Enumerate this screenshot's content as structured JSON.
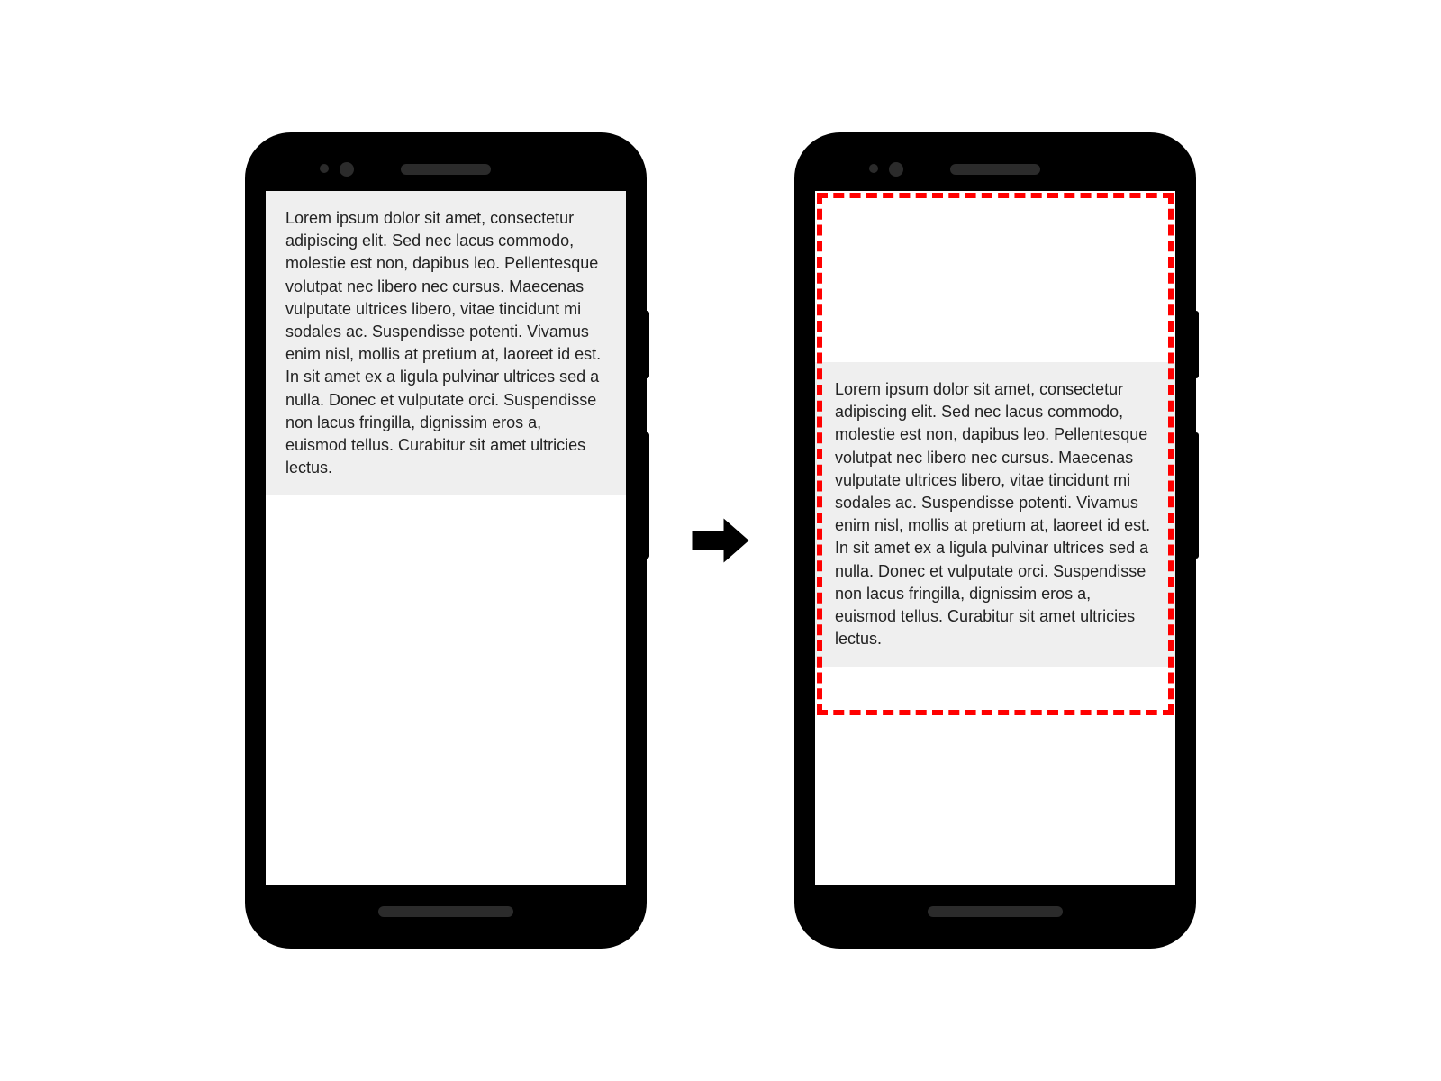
{
  "phone_left": {
    "body_text": "Lorem ipsum dolor sit amet, consectetur adipiscing elit. Sed nec lacus commodo, molestie est non, dapibus leo. Pellentesque volutpat nec libero nec cursus. Maecenas vulputate ultrices libero, vitae tincidunt mi sodales ac. Suspendisse potenti. Vivamus enim nisl, mollis at pretium at, laoreet id est. In sit amet ex a ligula pulvinar ultrices sed a nulla. Donec et vulputate orci. Suspendisse non lacus fringilla, dignissim eros a, euismod tellus. Curabitur sit amet ultricies lectus."
  },
  "phone_right": {
    "body_text": "Lorem ipsum dolor sit amet, consectetur adipiscing elit. Sed nec lacus commodo, molestie est non, dapibus leo. Pellentesque volutpat nec libero nec cursus. Maecenas vulputate ultrices libero, vitae tincidunt mi sodales ac. Suspendisse potenti. Vivamus enim nisl, mollis at pretium at, laoreet id est. In sit amet ex a ligula pulvinar ultrices sed a nulla. Donec et vulputate orci. Suspendisse non lacus fringilla, dignissim eros a, euismod tellus. Curabitur sit amet ultricies lectus."
  },
  "colors": {
    "highlight_border": "#ff0000",
    "text_bg": "#efefef",
    "phone_body": "#000000"
  }
}
